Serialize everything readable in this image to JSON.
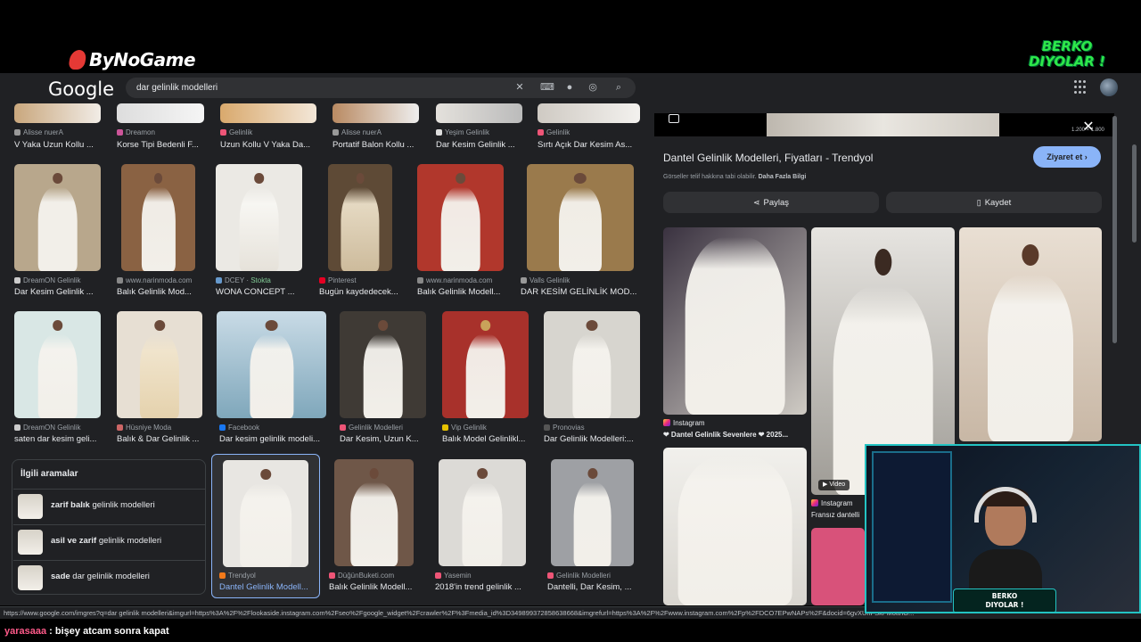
{
  "overlay": {
    "brand": "ByNoGame",
    "streamer": [
      "BERKO",
      "DIYOLAR !"
    ],
    "cam_badge": [
      "BERKO",
      "DIYOLAR !"
    ]
  },
  "google": {
    "logo": "Google",
    "search_value": "dar gelinlik modelleri"
  },
  "grid": {
    "row1": [
      {
        "source": "Alisse nuerA",
        "caption": "V Yaka Uzun Kollu ..."
      },
      {
        "source": "Dreamon",
        "caption": "Korse Tipi Bedenli F..."
      },
      {
        "source": "Gelinlik",
        "caption": "Uzun Kollu V Yaka Da..."
      },
      {
        "source": "Alisse nuerA",
        "caption": "Portatif Balon Kollu ..."
      },
      {
        "source": "Yeşim Gelinlik",
        "caption": "Dar Kesim Gelinlik ..."
      },
      {
        "source": "Gelinlik",
        "caption": "Sırtı Açık Dar Kesim As..."
      }
    ],
    "row2": [
      {
        "source": "DreamON Gelinlik",
        "caption": "Dar Kesim Gelinlik ..."
      },
      {
        "source": "www.narinmoda.com",
        "caption": "Balık Gelinlik Mod..."
      },
      {
        "source": "DCEY",
        "stock": "Stokta",
        "caption": "WONA CONCEPT ..."
      },
      {
        "source": "Pinterest",
        "caption": "Bugün kaydedecek..."
      },
      {
        "source": "www.narinmoda.com",
        "caption": "Balık Gelinlik Modell..."
      },
      {
        "source": "Valls Gelinlik",
        "caption": "DAR KESİM GELİNLİK MOD..."
      }
    ],
    "row3": [
      {
        "source": "DreamON Gelinlik",
        "caption": "saten dar kesim geli..."
      },
      {
        "source": "Hüsniye Moda",
        "caption": "Balık & Dar Gelinlik ..."
      },
      {
        "source": "Facebook",
        "caption": "Dar kesim gelinlik modeli..."
      },
      {
        "source": "Gelinlik Modelleri",
        "caption": "Dar Kesim, Uzun K..."
      },
      {
        "source": "Vip Gelinlik",
        "caption": "Balık Model Gelinlikl..."
      },
      {
        "source": "Pronovias",
        "caption": "Dar Gelinlik Modelleri:..."
      }
    ],
    "row4": [
      {
        "source": "Trendyol",
        "caption": "Dantel Gelinlik Modell..."
      },
      {
        "source": "DüğünBuketi.com",
        "caption": "Balık Gelinlik Modell..."
      },
      {
        "source": "Yasemin",
        "caption": "2018'in trend gelinlik ..."
      },
      {
        "source": "Gelinlik Modelleri",
        "caption": "Dantelli, Dar Kesim, ..."
      }
    ]
  },
  "related": {
    "title": "İlgili aramalar",
    "items": [
      {
        "bold": "zarif balık",
        "rest": " gelinlik modelleri"
      },
      {
        "bold": "asil ve zarif",
        "rest": " gelinlik modelleri"
      },
      {
        "bold": "sade",
        "rest": " dar gelinlik modelleri"
      }
    ]
  },
  "panel": {
    "counter": "1.200 × 1.800",
    "title": "Dantel Gelinlik Modelleri, Fiyatları - Trendyol",
    "visit": "Ziyaret et",
    "sub_text": "Görseller telif hakkına tabi olabilir.",
    "sub_link": "Daha Fazla Bilgi",
    "share": "Paylaş",
    "save": "Kaydet",
    "ig1_source": "Instagram",
    "ig1_caption": "❤ Dantel Gelinlik Sevenlere ❤ 2025...",
    "ig2_source": "Instagram",
    "ig2_caption": "Fransız dantelli",
    "video": "▶ Video"
  },
  "status_url": "https://www.google.com/imgres?q=dar gelinlik modelleri&imgurl=https%3A%2F%2Flookaside.instagram.com%2Fseo%2Fgoogle_widget%2Fcrawler%2F%3Fmedia_id%3D349899372858638668&imgrefurl=https%3A%2F%2Fwww.instagram.com%2Fp%2FDCO7EPwNAPs%2F&docid=6gvXUnFSkFMottnG...",
  "chat": {
    "user": "yarasaaa",
    "message": " : bişey atcam sonra kapat"
  },
  "colors": {
    "accent": "#8ab4f8",
    "bg": "#202124",
    "streamer_green": "#2ee84a",
    "cam_border": "#23c3c3"
  }
}
